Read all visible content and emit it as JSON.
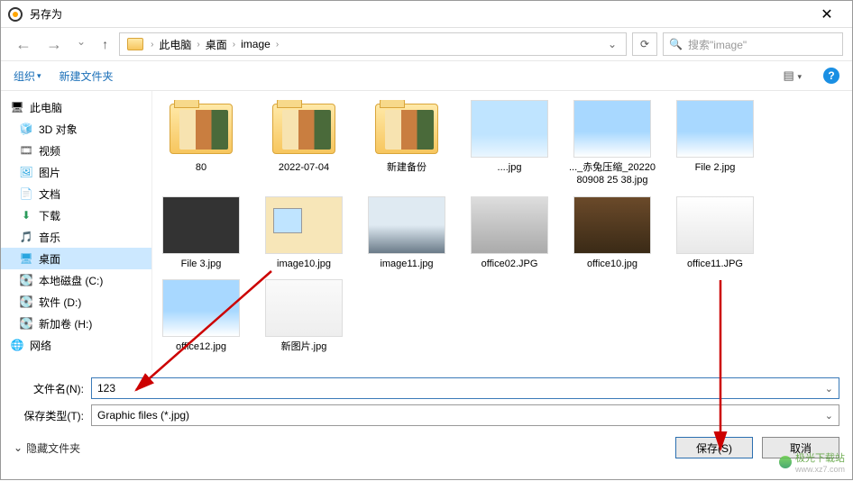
{
  "titlebar": {
    "title": "另存为",
    "close": "✕"
  },
  "breadcrumb": {
    "items": [
      "此电脑",
      "桌面",
      "image"
    ],
    "dropdown": "⌄"
  },
  "nav": {
    "back": "←",
    "forward": "→",
    "dropdown": "⌄",
    "up": "↑",
    "refresh": "⟳"
  },
  "search": {
    "icon": "🔍",
    "placeholder": "搜索\"image\""
  },
  "toolbar": {
    "organize": "组织",
    "organize_chev": "▾",
    "new_folder": "新建文件夹",
    "view_icon": "▤",
    "view_chev": "▾",
    "help": "?"
  },
  "sidebar": [
    {
      "icon": "🖥",
      "label": "此电脑",
      "root": true
    },
    {
      "icon": "🧊",
      "label": "3D 对象",
      "color": "#2aa6e0"
    },
    {
      "icon": "🎞",
      "label": "视频",
      "color": "#555"
    },
    {
      "icon": "🖼",
      "label": "图片",
      "color": "#2aa6e0"
    },
    {
      "icon": "📄",
      "label": "文档",
      "color": "#555"
    },
    {
      "icon": "⬇",
      "label": "下载",
      "color": "#2a9a5a"
    },
    {
      "icon": "🎵",
      "label": "音乐",
      "color": "#2aa6e0"
    },
    {
      "icon": "🖥",
      "label": "桌面",
      "selected": true,
      "color": "#2aa6e0"
    },
    {
      "icon": "💽",
      "label": "本地磁盘 (C:)",
      "color": "#888"
    },
    {
      "icon": "💽",
      "label": "软件 (D:)",
      "color": "#888"
    },
    {
      "icon": "💽",
      "label": "新加卷 (H:)",
      "color": "#888"
    },
    {
      "icon": "🌐",
      "label": "网络",
      "root": true,
      "color": "#2aa6e0"
    }
  ],
  "files": [
    {
      "name": "80",
      "type": "folder",
      "thumb": "collage"
    },
    {
      "name": "2022-07-04",
      "type": "folder",
      "thumb": "collage"
    },
    {
      "name": "新建备份",
      "type": "folder",
      "thumb": "collage"
    },
    {
      "name": "....jpg",
      "type": "image",
      "thumb": "sky"
    },
    {
      "name": "..._赤兔压缩_2022080908 25 38.jpg",
      "type": "image",
      "thumb": "sky2"
    },
    {
      "name": "File 2.jpg",
      "type": "image",
      "thumb": "sky2"
    },
    {
      "name": "File 3.jpg",
      "type": "image",
      "thumb": "dark"
    },
    {
      "name": "image10.jpg",
      "type": "image",
      "thumb": "frame"
    },
    {
      "name": "image11.jpg",
      "type": "image",
      "thumb": "seascape"
    },
    {
      "name": "office02.JPG",
      "type": "image",
      "thumb": "bw"
    },
    {
      "name": "office10.jpg",
      "type": "image",
      "thumb": "brown"
    },
    {
      "name": "office11.JPG",
      "type": "image",
      "thumb": "portrait"
    },
    {
      "name": "office12.jpg",
      "type": "image",
      "thumb": "sky2"
    },
    {
      "name": "新图片.jpg",
      "type": "image",
      "thumb": "sketch"
    }
  ],
  "form": {
    "filename_label": "文件名(N):",
    "filename_value": "123",
    "filetype_label": "保存类型(T):",
    "filetype_value": "Graphic files (*.jpg)",
    "chev": "⌄"
  },
  "footer": {
    "hide_folders_icon": "⌄",
    "hide_folders": "隐藏文件夹",
    "save": "保存(S)",
    "cancel": "取消"
  },
  "watermark": {
    "text": "极光下载站",
    "sub": "www.xz7.com"
  }
}
